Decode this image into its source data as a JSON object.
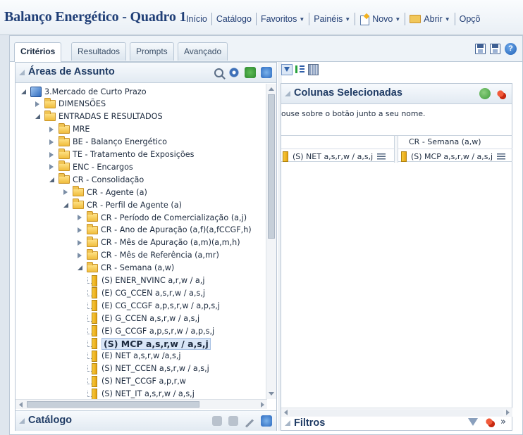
{
  "header": {
    "title": "Balanço Energético - Quadro 1",
    "nav": [
      {
        "label": "Início",
        "dropdown": false,
        "icon": ""
      },
      {
        "label": "Catálogo",
        "dropdown": false,
        "icon": ""
      },
      {
        "label": "Favoritos",
        "dropdown": true,
        "icon": ""
      },
      {
        "label": "Painéis",
        "dropdown": true,
        "icon": ""
      },
      {
        "label": "Novo",
        "dropdown": true,
        "icon": "new-document-icon"
      },
      {
        "label": "Abrir",
        "dropdown": true,
        "icon": "folder-icon"
      },
      {
        "label": "Opçõ",
        "dropdown": false,
        "icon": ""
      }
    ]
  },
  "tabs": [
    {
      "label": "Critérios",
      "active": true
    },
    {
      "label": "Resultados",
      "active": false
    },
    {
      "label": "Prompts",
      "active": false
    },
    {
      "label": "Avançado",
      "active": false
    }
  ],
  "subject_areas": {
    "title": "Áreas de Assunto",
    "tree": [
      {
        "label": "3.Mercado de Curto Prazo",
        "level": 0,
        "type": "cube",
        "state": "expanded"
      },
      {
        "label": "DIMENSÕES",
        "level": 1,
        "type": "folder",
        "state": "collapsed"
      },
      {
        "label": "ENTRADAS E RESULTADOS",
        "level": 1,
        "type": "folder",
        "state": "expanded"
      },
      {
        "label": "MRE",
        "level": 2,
        "type": "folder",
        "state": "collapsed"
      },
      {
        "label": "BE - Balanço Energético",
        "level": 2,
        "type": "folder",
        "state": "collapsed"
      },
      {
        "label": "TE - Tratamento de Exposições",
        "level": 2,
        "type": "folder",
        "state": "collapsed"
      },
      {
        "label": "ENC - Encargos",
        "level": 2,
        "type": "folder",
        "state": "collapsed"
      },
      {
        "label": "CR - Consolidação",
        "level": 2,
        "type": "folder",
        "state": "expanded"
      },
      {
        "label": "CR - Agente (a)",
        "level": 3,
        "type": "folder",
        "state": "collapsed"
      },
      {
        "label": "CR - Perfil de Agente (a)",
        "level": 3,
        "type": "folder",
        "state": "expanded"
      },
      {
        "label": "CR - Período de Comercialização (a,j)",
        "level": 4,
        "type": "folder",
        "state": "collapsed"
      },
      {
        "label": "CR - Ano de Apuração (a,f)(a,fCCGF,h)",
        "level": 4,
        "type": "folder",
        "state": "collapsed"
      },
      {
        "label": "CR - Mês de Apuração (a,m)(a,m,h)",
        "level": 4,
        "type": "folder",
        "state": "collapsed"
      },
      {
        "label": "CR - Mês de Referência (a,mr)",
        "level": 4,
        "type": "folder",
        "state": "collapsed"
      },
      {
        "label": "CR - Semana (a,w)",
        "level": 4,
        "type": "folder",
        "state": "expanded"
      },
      {
        "label": "(S) ENER_NVINC a,r,w / a,j",
        "level": 5,
        "type": "column",
        "state": ""
      },
      {
        "label": "(E) CG_CCEN a,s,r,w / a,s,j",
        "level": 5,
        "type": "column",
        "state": ""
      },
      {
        "label": "(E) CG_CCGF a,p,s,r,w / a,p,s,j",
        "level": 5,
        "type": "column",
        "state": ""
      },
      {
        "label": "(E) G_CCEN a,s,r,w / a,s,j",
        "level": 5,
        "type": "column",
        "state": ""
      },
      {
        "label": "(E) G_CCGF a,p,s,r,w / a,p,s,j",
        "level": 5,
        "type": "column",
        "state": ""
      },
      {
        "label": "(S) MCP a,s,r,w / a,s,j",
        "level": 5,
        "type": "column",
        "state": "selected"
      },
      {
        "label": "(E) NET a,s,r,w /a,s,j",
        "level": 5,
        "type": "column",
        "state": ""
      },
      {
        "label": "(S) NET_CCEN a,s,r,w / a,s,j",
        "level": 5,
        "type": "column",
        "state": ""
      },
      {
        "label": "(S) NET_CCGF a,p,r,w",
        "level": 5,
        "type": "column",
        "state": ""
      },
      {
        "label": "(S) NET_IT a,s,r,w / a,s,j",
        "level": 5,
        "type": "column",
        "state": ""
      }
    ]
  },
  "catalog": {
    "title": "Catálogo"
  },
  "selected_columns": {
    "title": "Colunas Selecionadas",
    "hint": "ouse sobre o botão junto a seu nome.",
    "groups": [
      {
        "header": "",
        "column": "(S) NET a,s,r,w / a,s,j"
      },
      {
        "header": "CR - Semana (a,w)",
        "column": "(S) MCP a,s,r,w / a,s,j"
      }
    ]
  },
  "filters": {
    "title": "Filtros",
    "expand": "»"
  },
  "colors": {
    "title_blue": "#203f77",
    "selected_bg": "#d9e6f7",
    "folder": "#f0bd3d"
  }
}
